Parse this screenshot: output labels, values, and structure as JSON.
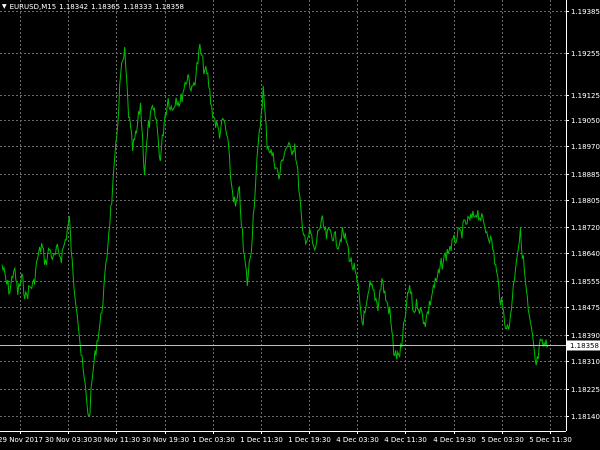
{
  "window": {
    "symbol_timeframe": "EURUSD,M15",
    "ohlc": [
      "1.18342",
      "1.18365",
      "1.18333",
      "1.18358"
    ],
    "menu_icon": "triangle-down-icon"
  },
  "colors": {
    "background": "#000000",
    "grid": "#6b6b6b",
    "price_line": "#00c000",
    "text": "#ffffff",
    "bid_line": "#bfbfbf",
    "bid_label_bg": "#ffffff",
    "bid_label_text": "#000000"
  },
  "chart_data": {
    "type": "line",
    "title": "EURUSD,M15",
    "grid": true,
    "current_price": 1.18358,
    "current_price_label": "1.18358",
    "ylim": [
      1.18095,
      1.19418
    ],
    "y_ticks": [
      1.19385,
      1.19255,
      1.19125,
      1.1905,
      1.1897,
      1.18885,
      1.18805,
      1.1872,
      1.1864,
      1.18555,
      1.18475,
      1.1839,
      1.1831,
      1.18225,
      1.1814
    ],
    "y_tick_labels": [
      "1.19385",
      "1.19255",
      "1.19125",
      "1.19050",
      "1.18970",
      "1.18885",
      "1.18805",
      "1.18720",
      "1.18640",
      "1.18555",
      "1.18475",
      "1.18390",
      "1.18310",
      "1.18225",
      "1.18140"
    ],
    "x_tick_labels": [
      "29 Nov 2017",
      "30 Nov 03:30",
      "30 Nov 11:30",
      "30 Nov 19:30",
      "1 Dec 03:30",
      "1 Dec 11:30",
      "1 Dec 19:30",
      "4 Dec 03:30",
      "4 Dec 11:30",
      "4 Dec 19:30",
      "5 Dec 03:30",
      "5 Dec 11:30"
    ],
    "series": [
      {
        "x_index": [
          0,
          4,
          8,
          12,
          16,
          20,
          24,
          28,
          32,
          36,
          40,
          44,
          48,
          52,
          56,
          60,
          64,
          68,
          72,
          76,
          80,
          84,
          88,
          92,
          96,
          100,
          104,
          108,
          112,
          116,
          120,
          124,
          128,
          132,
          136,
          140,
          144,
          148,
          152,
          156,
          160,
          164,
          168,
          172,
          176,
          180,
          184,
          188,
          192,
          196,
          200,
          204,
          208,
          212,
          216,
          220,
          224,
          228,
          232,
          236,
          240,
          244,
          248,
          252,
          256,
          260,
          264,
          268,
          272,
          276,
          280,
          284,
          288,
          292,
          296,
          300,
          304,
          308,
          312,
          316,
          320,
          324,
          328,
          332,
          336,
          340,
          344,
          348,
          352,
          356,
          360,
          364,
          368,
          372,
          376,
          380,
          384,
          388,
          392,
          396,
          400,
          404,
          408,
          412,
          416,
          420,
          424,
          428,
          432,
          436,
          440,
          444,
          448,
          452,
          456,
          460,
          464,
          468,
          472,
          476,
          480,
          484,
          488,
          492,
          496,
          500,
          504,
          508,
          512,
          516,
          520,
          524,
          528,
          532,
          536,
          540,
          544,
          548,
          552
        ],
        "values": [
          1.18605,
          1.18555,
          1.18525,
          1.18595,
          1.1852,
          1.18565,
          1.18505,
          1.18535,
          1.18545,
          1.18625,
          1.18665,
          1.1861,
          1.18655,
          1.1862,
          1.1865,
          1.1863,
          1.1868,
          1.18745,
          1.1856,
          1.1847,
          1.1833,
          1.1823,
          1.1813,
          1.1828,
          1.1837,
          1.1844,
          1.1856,
          1.1871,
          1.1884,
          1.19,
          1.1919,
          1.19255,
          1.1907,
          1.1896,
          1.1901,
          1.191,
          1.1889,
          1.1903,
          1.1908,
          1.1905,
          1.18925,
          1.1905,
          1.19115,
          1.1908,
          1.1912,
          1.191,
          1.1915,
          1.1919,
          1.19135,
          1.1919,
          1.1927,
          1.1921,
          1.1918,
          1.19085,
          1.1904,
          1.1901,
          1.1905,
          1.1899,
          1.1885,
          1.1878,
          1.1883,
          1.1865,
          1.1855,
          1.1866,
          1.1885,
          1.19,
          1.19145,
          1.1898,
          1.1895,
          1.1892,
          1.1887,
          1.1894,
          1.1897,
          1.18955,
          1.18975,
          1.1885,
          1.1869,
          1.1869,
          1.187,
          1.1864,
          1.18715,
          1.18735,
          1.1869,
          1.1871,
          1.1869,
          1.1867,
          1.187,
          1.1868,
          1.1862,
          1.1859,
          1.1853,
          1.1843,
          1.1846,
          1.1854,
          1.1852,
          1.1848,
          1.1856,
          1.185,
          1.1846,
          1.1834,
          1.1832,
          1.1835,
          1.1846,
          1.1854,
          1.1846,
          1.1849,
          1.18455,
          1.1843,
          1.1848,
          1.18535,
          1.1856,
          1.18605,
          1.1863,
          1.18655,
          1.1867,
          1.18695,
          1.187,
          1.1873,
          1.1874,
          1.1875,
          1.1877,
          1.1875,
          1.1872,
          1.187,
          1.1866,
          1.1858,
          1.185,
          1.1844,
          1.184,
          1.1851,
          1.1863,
          1.187,
          1.1859,
          1.1846,
          1.1838,
          1.1829,
          1.18358,
          1.18358,
          1.18358
        ]
      }
    ]
  }
}
